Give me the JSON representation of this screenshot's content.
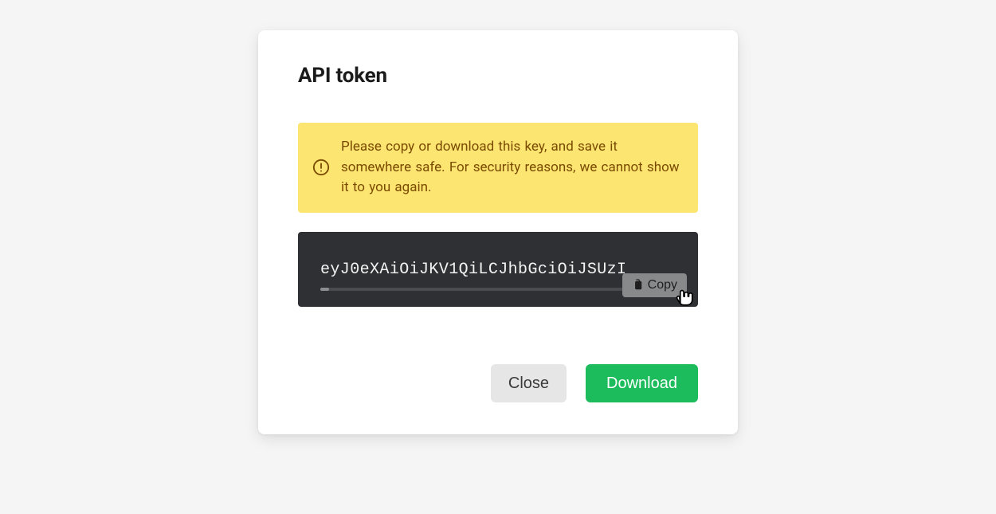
{
  "dialog": {
    "title": "API token",
    "warning_text": "Please copy or download this key, and save it somewhere safe. For security reasons, we cannot show it to you again.",
    "token_visible_text": "eyJ0eXAiOiJKV1QiLCJhbGciOiJSUzI",
    "copy_label": "Copy",
    "close_label": "Close",
    "download_label": "Download"
  },
  "colors": {
    "warning_bg": "#fce571",
    "warning_text": "#7a4a00",
    "token_bg": "#2f3033",
    "primary": "#1cbb5b"
  }
}
